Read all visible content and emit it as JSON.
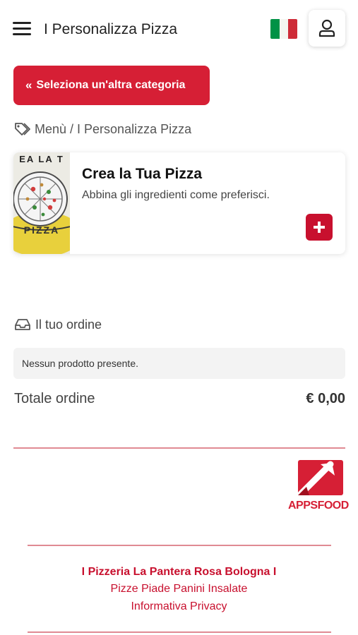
{
  "header": {
    "title": "I Personalizza Pizza",
    "menu_icon": "hamburger-menu-icon",
    "flag": "italy-flag",
    "user_icon": "user-icon"
  },
  "category_button": {
    "label": "Seleziona un'altra categoria",
    "icon": "double-chevron-left-icon"
  },
  "breadcrumb": {
    "icon": "tag-icon",
    "text": "Menù / I Personalizza Pizza"
  },
  "product": {
    "image_text_top": "EA LA T",
    "image_text_bottom": "PIZZA",
    "title": "Crea la Tua Pizza",
    "description": "Abbina gli ingredienti come preferisci.",
    "add_icon": "plus-icon"
  },
  "order": {
    "icon": "inbox-icon",
    "heading": "Il tuo ordine",
    "empty_message": "Nessun prodotto presente.",
    "total_label": "Totale ordine",
    "total_value": "€ 0,00"
  },
  "footer": {
    "logo_text": "APPSFOOD",
    "business_name": "I Pizzeria La Pantera Rosa Bologna I",
    "subtitle": "Pizze Piade Panini Insalate",
    "privacy_link": "Informativa Privacy"
  },
  "colors": {
    "accent": "#d61f35",
    "accent_dark": "#c8102e",
    "line": "#e08a93",
    "flag_green": "#009246",
    "flag_white": "#f4f5f0",
    "flag_red": "#ce2b37",
    "pizza_yellow": "#e8d03c"
  }
}
